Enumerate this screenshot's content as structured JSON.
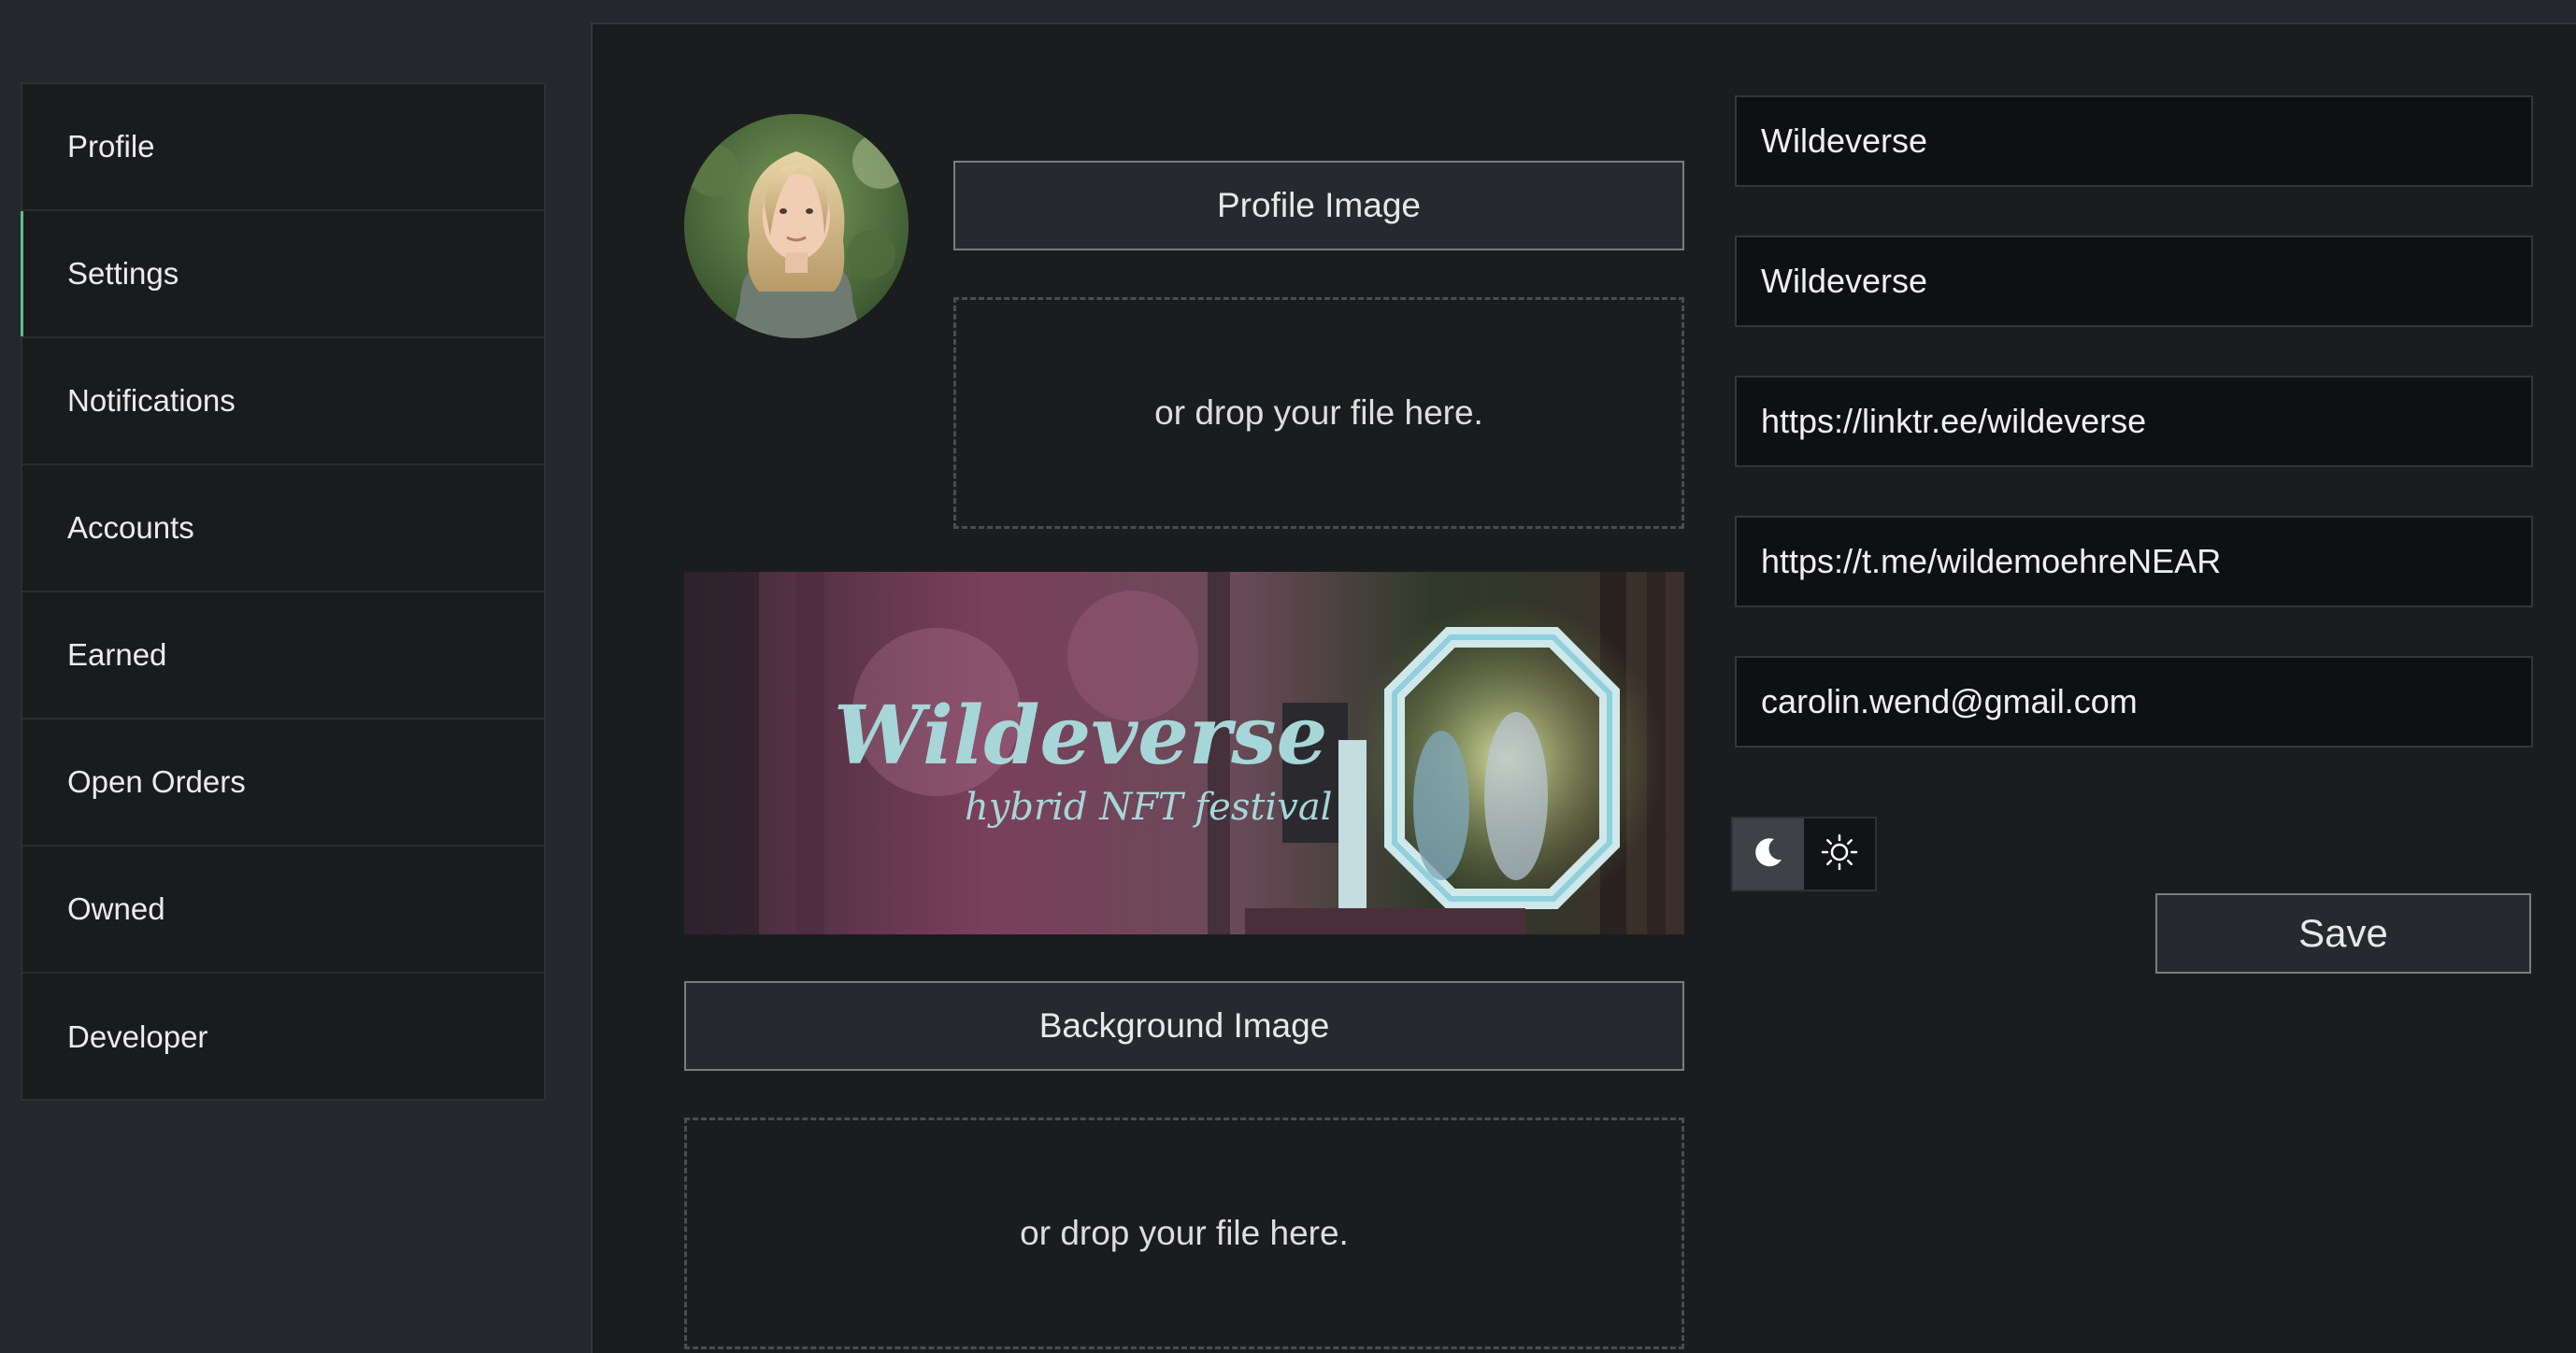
{
  "sidebar": {
    "items": [
      {
        "label": "Profile"
      },
      {
        "label": "Settings"
      },
      {
        "label": "Notifications"
      },
      {
        "label": "Accounts"
      },
      {
        "label": "Earned"
      },
      {
        "label": "Open Orders"
      },
      {
        "label": "Owned"
      },
      {
        "label": "Developer"
      }
    ],
    "active": "Settings",
    "accent_color": "#5fbf8a"
  },
  "profile_image": {
    "button_label": "Profile Image",
    "drop_text": "or drop your file here."
  },
  "background_image": {
    "button_label": "Background Image",
    "drop_text": "or drop your file here.",
    "banner_title": "Wildeverse",
    "banner_subtitle": "hybrid NFT festival"
  },
  "form": {
    "name": "Wildeverse",
    "display_name": "Wildeverse",
    "website": "https://linktr.ee/wildeverse",
    "telegram": "https://t.me/wildemoehreNEAR",
    "email": "carolin.wend@gmail.com"
  },
  "theme_toggle": {
    "dark_icon": "moon-icon",
    "light_icon": "sun-icon",
    "selected": "dark"
  },
  "save_label": "Save"
}
